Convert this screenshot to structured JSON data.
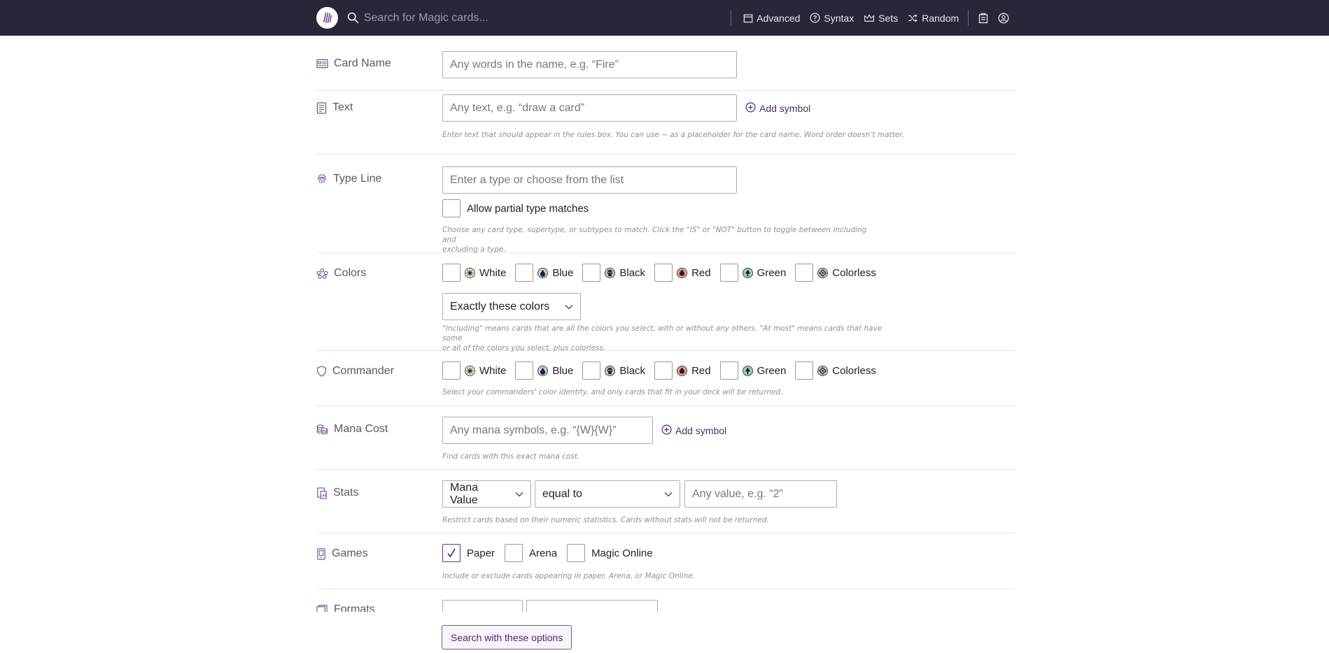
{
  "header": {
    "search_placeholder": "Search for Magic cards...",
    "nav": {
      "advanced": "Advanced",
      "syntax": "Syntax",
      "sets": "Sets",
      "random": "Random"
    }
  },
  "form": {
    "card_name": {
      "label": "Card Name",
      "placeholder": "Any words in the name, e.g. “Fire”"
    },
    "text": {
      "label": "Text",
      "placeholder": "Any text, e.g. “draw a card”",
      "add_symbol": "Add symbol",
      "help": "Enter text that should appear in the rules box. You can use ~ as a placeholder for the card name. Word order doesn’t matter."
    },
    "type_line": {
      "label": "Type Line",
      "placeholder": "Enter a type or choose from the list",
      "partial_label": "Allow partial type matches",
      "help_1": "Choose any card type, supertype, or subtypes to match. Click the \"IS\" or \"NOT\" button to toggle between including and",
      "help_2": "excluding a type."
    },
    "colors": {
      "label": "Colors",
      "options": [
        "White",
        "Blue",
        "Black",
        "Red",
        "Green",
        "Colorless"
      ],
      "mode": "Exactly these colors",
      "help_1": "\"Including\" means cards that are all the colors you select, with or without any others. \"At most\" means cards that have some",
      "help_2": "or all of the colors you select, plus colorless."
    },
    "commander": {
      "label": "Commander",
      "options": [
        "White",
        "Blue",
        "Black",
        "Red",
        "Green",
        "Colorless"
      ],
      "help": "Select your commanders' color identity, and only cards that fit in your deck will be returned."
    },
    "mana_cost": {
      "label": "Mana Cost",
      "placeholder": "Any mana symbols, e.g. “{W}{W}”",
      "add_symbol": "Add symbol",
      "help": "Find cards with this exact mana cost."
    },
    "stats": {
      "label": "Stats",
      "stat": "Mana Value",
      "comparator": "equal to",
      "value_placeholder": "Any value, e.g. “2”",
      "help": "Restrict cards based on their numeric statistics. Cards without stats will not be returned."
    },
    "games": {
      "label": "Games",
      "paper": "Paper",
      "paper_checked": true,
      "arena": "Arena",
      "arena_checked": false,
      "mtgo": "Magic Online",
      "mtgo_checked": false,
      "help": "Include or exclude cards appearing in paper, Arena, or Magic Online."
    },
    "formats": {
      "label": "Formats"
    }
  },
  "submit_label": "Search with these options",
  "colors": {
    "header_bg": "#2b253a",
    "accent": "#4c2c6e"
  }
}
